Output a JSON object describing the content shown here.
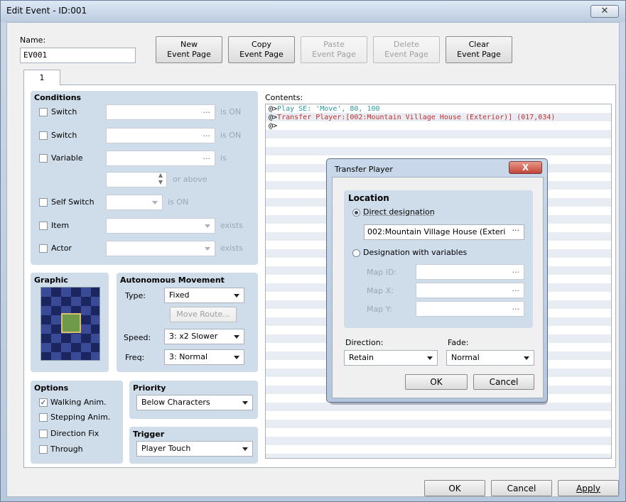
{
  "window": {
    "title": "Edit Event - ID:001",
    "close": "✕"
  },
  "name": {
    "label": "Name:",
    "value": "EV001"
  },
  "toolbar": {
    "new": [
      "New",
      "Event Page"
    ],
    "copy": [
      "Copy",
      "Event Page"
    ],
    "paste": [
      "Paste",
      "Event Page"
    ],
    "delete": [
      "Delete",
      "Event Page"
    ],
    "clear": [
      "Clear",
      "Event Page"
    ]
  },
  "tab": {
    "label": "1"
  },
  "conditions": {
    "title": "Conditions",
    "switch1": "Switch",
    "switch1_suffix": "is ON",
    "switch2": "Switch",
    "switch2_suffix": "is ON",
    "variable": "Variable",
    "variable_suffix": "is",
    "or_above": "or above",
    "self_switch": "Self Switch",
    "self_switch_suffix": "is ON",
    "item": "Item",
    "item_suffix": "exists",
    "actor": "Actor",
    "actor_suffix": "exists",
    "dots": "..."
  },
  "graphic": {
    "title": "Graphic"
  },
  "movement": {
    "title": "Autonomous Movement",
    "type_label": "Type:",
    "type_value": "Fixed",
    "move_route": "Move Route...",
    "speed_label": "Speed:",
    "speed_value": "3: x2 Slower",
    "freq_label": "Freq:",
    "freq_value": "3: Normal"
  },
  "options": {
    "title": "Options",
    "walking": "Walking Anim.",
    "walking_checked": true,
    "stepping": "Stepping Anim.",
    "direction_fix": "Direction Fix",
    "through": "Through"
  },
  "priority": {
    "title": "Priority",
    "value": "Below Characters"
  },
  "trigger": {
    "title": "Trigger",
    "value": "Player Touch"
  },
  "contents": {
    "label": "Contents:",
    "lines": [
      {
        "prefix": "@>",
        "text": "Play SE: 'Move', 80, 100",
        "color": "#2a9aa0"
      },
      {
        "prefix": "@>",
        "text": "Transfer Player:[002:Mountain Village House (Exterior)] (017,034)",
        "color": "#c03030"
      },
      {
        "prefix": "@>",
        "text": "",
        "color": "#000000"
      }
    ]
  },
  "transfer": {
    "title": "Transfer Player",
    "close": "X",
    "location": "Location",
    "direct": "Direct designation",
    "direct_value": "002:Mountain Village House (Exteri",
    "dots": "···",
    "with_vars": "Designation with variables",
    "map_id": "Map ID:",
    "map_x": "Map X:",
    "map_y": "Map Y:",
    "var_dots": "...",
    "direction_label": "Direction:",
    "direction_value": "Retain",
    "fade_label": "Fade:",
    "fade_value": "Normal",
    "ok": "OK",
    "cancel": "Cancel"
  },
  "footer": {
    "ok": "OK",
    "cancel": "Cancel",
    "apply": "Apply"
  }
}
